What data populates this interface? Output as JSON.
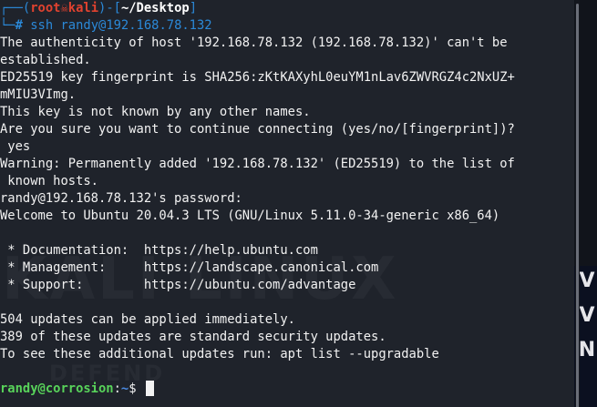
{
  "terminal": {
    "prompt": {
      "user": "root",
      "skull": "☠",
      "host": "kali",
      "path": "~/Desktop",
      "hash": "#",
      "command": "ssh randy@192.168.78.132"
    },
    "output": [
      "The authenticity of host '192.168.78.132 (192.168.78.132)' can't be",
      "established.",
      "ED25519 key fingerprint is SHA256:zKtKAXyhL0euYM1nLav6ZWVRGZ4c2NxUZ+",
      "mMIU3VImg.",
      "This key is not known by any other names.",
      "Are you sure you want to continue connecting (yes/no/[fingerprint])?",
      " yes",
      "Warning: Permanently added '192.168.78.132' (ED25519) to the list of",
      " known hosts.",
      "randy@192.168.78.132's password: ",
      "Welcome to Ubuntu 20.04.3 LTS (GNU/Linux 5.11.0-34-generic x86_64)",
      "",
      " * Documentation:  https://help.ubuntu.com",
      " * Management:     https://landscape.canonical.com",
      " * Support:        https://ubuntu.com/advantage",
      "",
      "504 updates can be applied immediately.",
      "389 of these updates are standard security updates.",
      "To see these additional updates run: apt list --upgradable",
      "",
      ""
    ],
    "remote_prompt": {
      "user_host": "randy@corrosion",
      "separator": ":",
      "path": "~",
      "symbol": "$"
    }
  },
  "background": {
    "watermark_main": "KALI LINUX",
    "watermark_sub": "DEFEND",
    "wallpaper_letters": [
      "V",
      "V",
      "N"
    ]
  },
  "colors": {
    "terminal_bg": "#1f232b",
    "root_red": "#e0422f",
    "prompt_blue": "#2b89d8",
    "remote_green": "#58d35a"
  }
}
